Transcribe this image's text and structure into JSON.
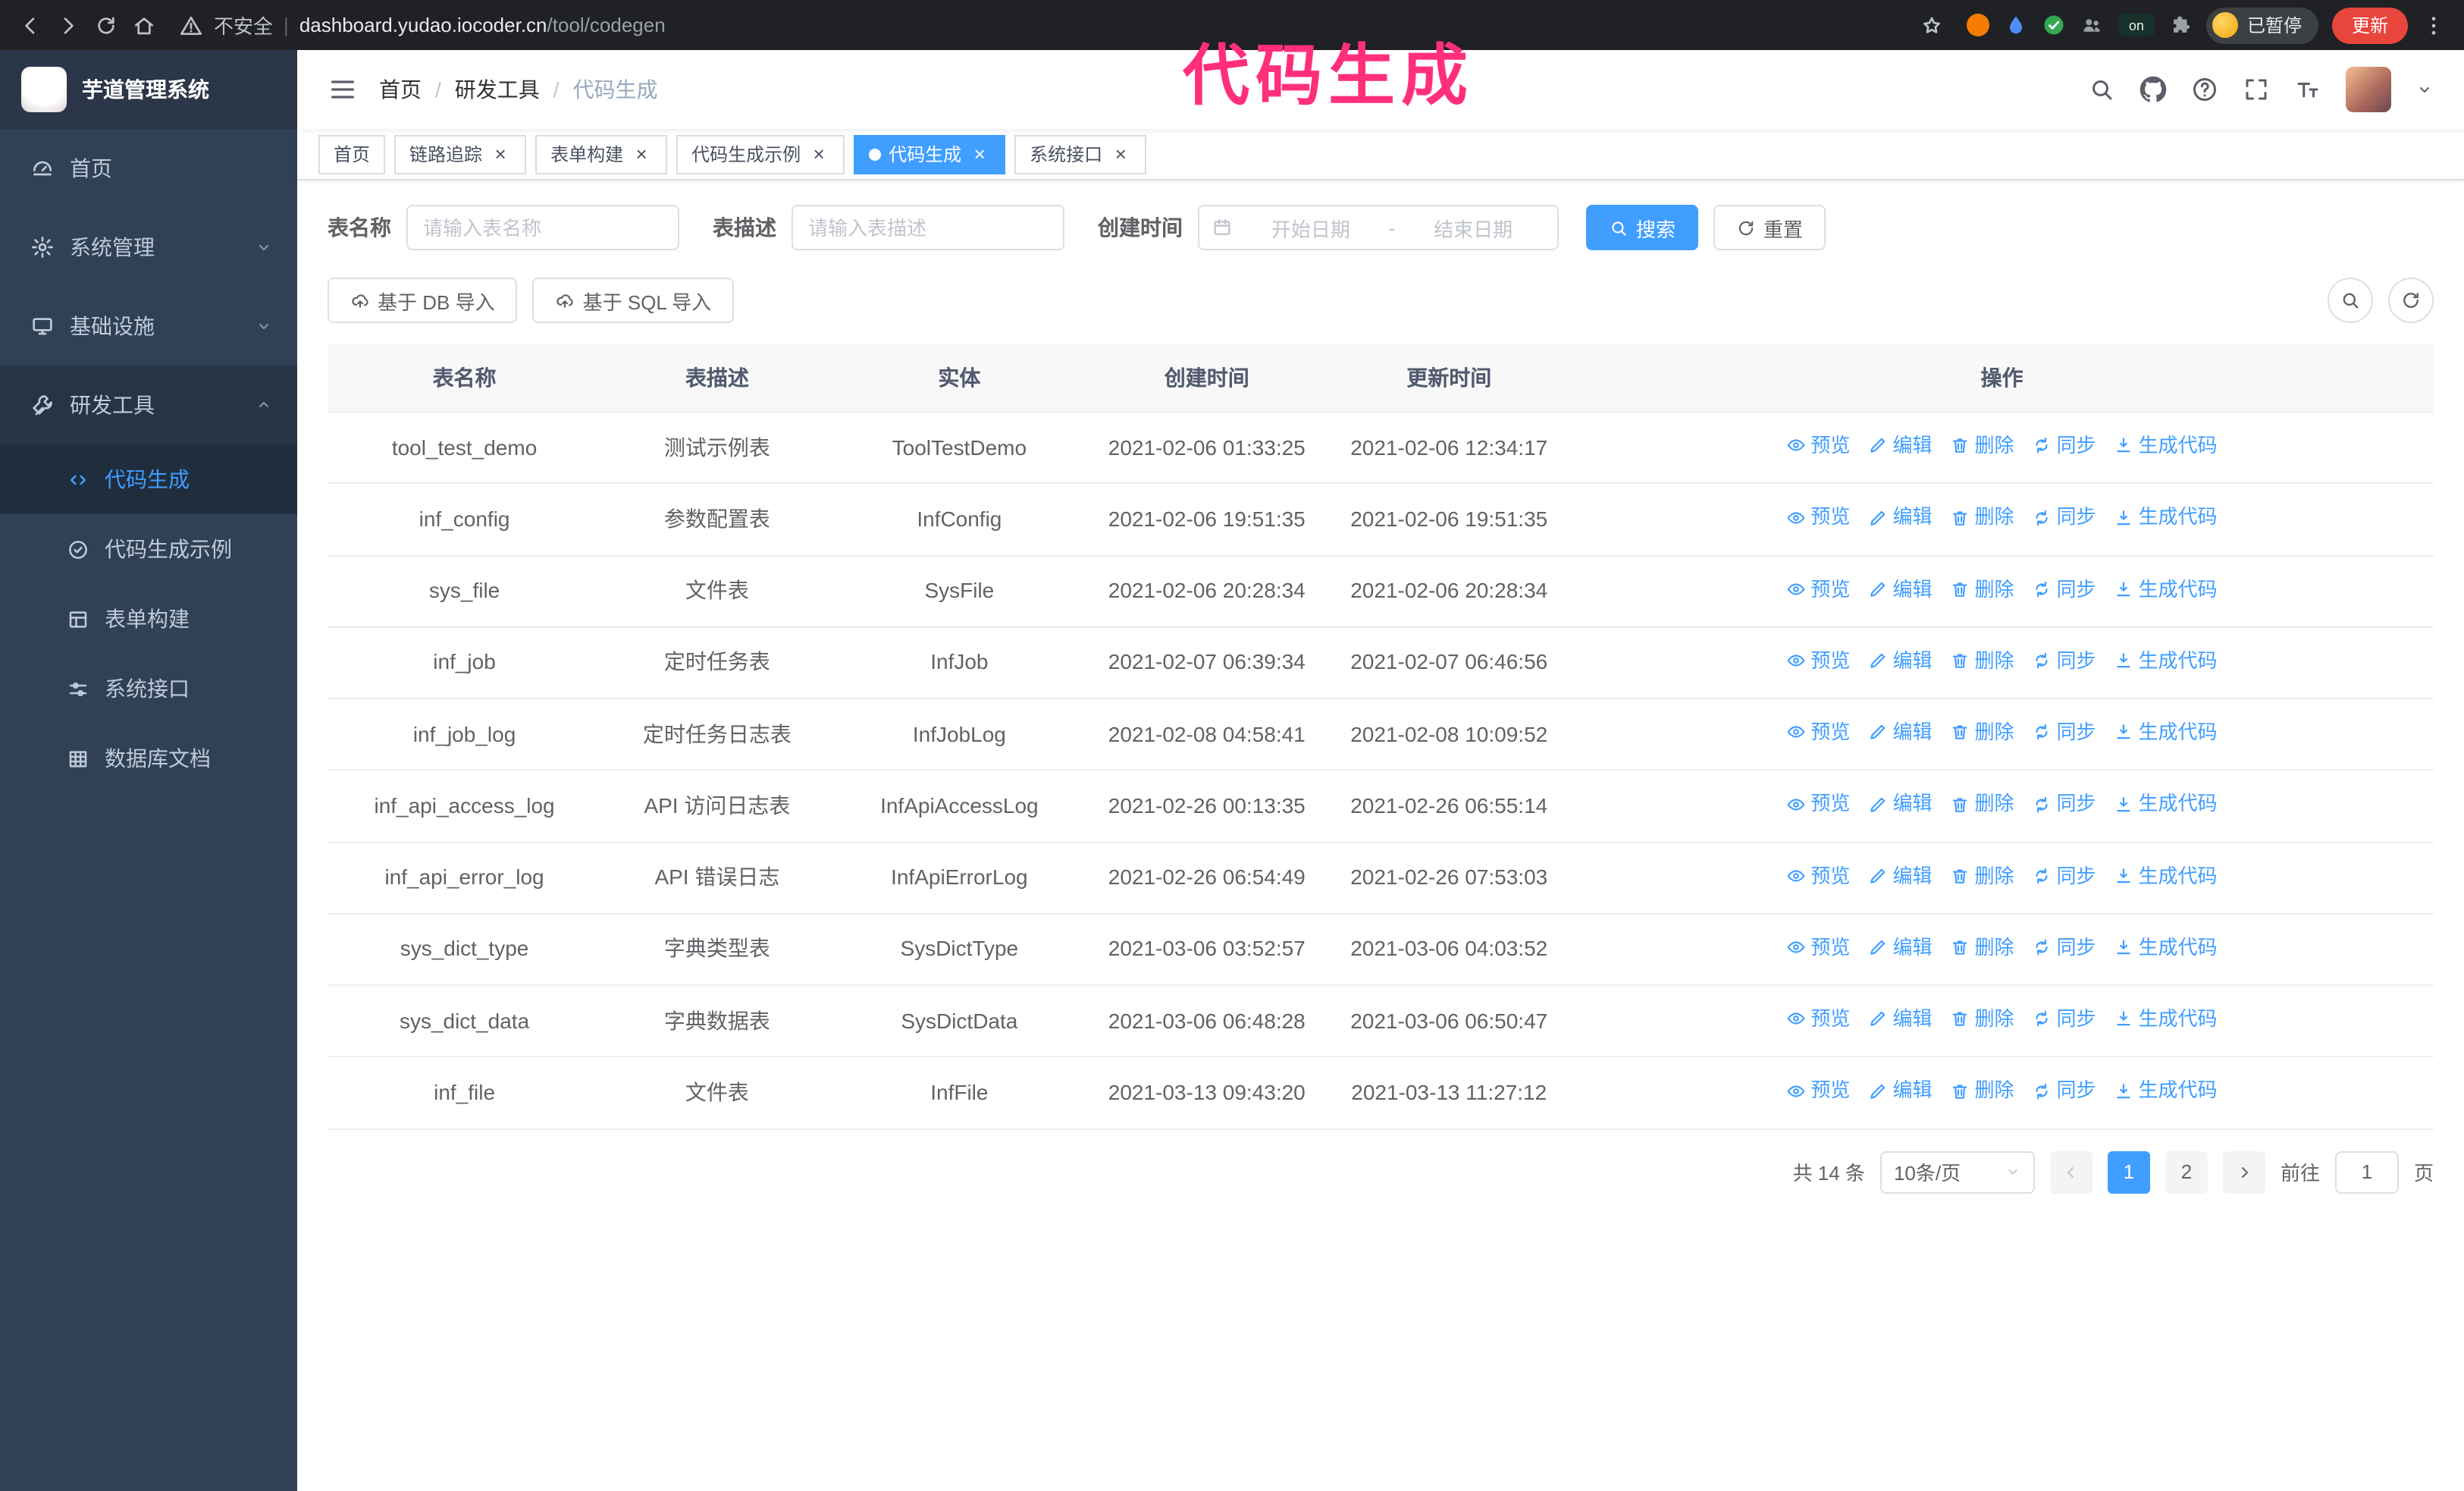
{
  "annotation": {
    "text": "代码生成",
    "color": "#ff2f7b"
  },
  "browser": {
    "security_label": "不安全",
    "url_host": "dashboard.yudao.iocoder.cn",
    "url_path": "/tool/codegen",
    "extension_on_badge": "on",
    "paused_badge": "已暂停",
    "update_button": "更新"
  },
  "sidebar": {
    "app_title": "芋道管理系统",
    "items": [
      {
        "id": "home",
        "label": "首页",
        "icon": "gauge",
        "expandable": false
      },
      {
        "id": "system",
        "label": "系统管理",
        "icon": "gear",
        "expandable": true,
        "expanded": false
      },
      {
        "id": "infra",
        "label": "基础设施",
        "icon": "monitor",
        "expandable": true,
        "expanded": false
      },
      {
        "id": "devtools",
        "label": "研发工具",
        "icon": "tools",
        "expandable": true,
        "expanded": true,
        "children": [
          {
            "id": "codegen",
            "label": "代码生成",
            "icon": "code",
            "active": true
          },
          {
            "id": "codegen-example",
            "label": "代码生成示例",
            "icon": "badge-check",
            "active": false
          },
          {
            "id": "form-builder",
            "label": "表单构建",
            "icon": "form",
            "active": false
          },
          {
            "id": "api",
            "label": "系统接口",
            "icon": "sliders",
            "active": false
          },
          {
            "id": "db-doc",
            "label": "数据库文档",
            "icon": "grid-table",
            "active": false
          }
        ]
      }
    ]
  },
  "header": {
    "breadcrumb": [
      "首页",
      "研发工具",
      "代码生成"
    ],
    "tools": [
      {
        "id": "search",
        "icon": "search"
      },
      {
        "id": "github",
        "icon": "github"
      },
      {
        "id": "help",
        "icon": "question"
      },
      {
        "id": "fullscreen",
        "icon": "fullscreen"
      },
      {
        "id": "font-size",
        "icon": "font-size"
      }
    ]
  },
  "tabs": [
    {
      "id": "home",
      "label": "首页",
      "closable": false,
      "active": false
    },
    {
      "id": "tracing",
      "label": "链路追踪",
      "closable": true,
      "active": false
    },
    {
      "id": "form-builder",
      "label": "表单构建",
      "closable": true,
      "active": false
    },
    {
      "id": "codegen-example",
      "label": "代码生成示例",
      "closable": true,
      "active": false
    },
    {
      "id": "codegen",
      "label": "代码生成",
      "closable": true,
      "active": true
    },
    {
      "id": "api",
      "label": "系统接口",
      "closable": true,
      "active": false
    }
  ],
  "filters": {
    "table_name_label": "表名称",
    "table_name_placeholder": "请输入表名称",
    "table_desc_label": "表描述",
    "table_desc_placeholder": "请输入表描述",
    "create_time_label": "创建时间",
    "date_start_placeholder": "开始日期",
    "date_separator": "-",
    "date_end_placeholder": "结束日期",
    "search_button": "搜索",
    "reset_button": "重置"
  },
  "toolbar": {
    "import_db_button": "基于 DB 导入",
    "import_sql_button": "基于 SQL 导入"
  },
  "table": {
    "columns": [
      "表名称",
      "表描述",
      "实体",
      "创建时间",
      "更新时间",
      "操作"
    ],
    "actions": [
      {
        "id": "preview",
        "label": "预览",
        "icon": "eye"
      },
      {
        "id": "edit",
        "label": "编辑",
        "icon": "edit"
      },
      {
        "id": "delete",
        "label": "删除",
        "icon": "trash"
      },
      {
        "id": "sync",
        "label": "同步",
        "icon": "sync"
      },
      {
        "id": "generate",
        "label": "生成代码",
        "icon": "download"
      }
    ],
    "rows": [
      {
        "name": "tool_test_demo",
        "desc": "测试示例表",
        "entity": "ToolTestDemo",
        "created": "2021-02-06 01:33:25",
        "updated": "2021-02-06 12:34:17"
      },
      {
        "name": "inf_config",
        "desc": "参数配置表",
        "entity": "InfConfig",
        "created": "2021-02-06 19:51:35",
        "updated": "2021-02-06 19:51:35"
      },
      {
        "name": "sys_file",
        "desc": "文件表",
        "entity": "SysFile",
        "created": "2021-02-06 20:28:34",
        "updated": "2021-02-06 20:28:34"
      },
      {
        "name": "inf_job",
        "desc": "定时任务表",
        "entity": "InfJob",
        "created": "2021-02-07 06:39:34",
        "updated": "2021-02-07 06:46:56"
      },
      {
        "name": "inf_job_log",
        "desc": "定时任务日志表",
        "entity": "InfJobLog",
        "created": "2021-02-08 04:58:41",
        "updated": "2021-02-08 10:09:52"
      },
      {
        "name": "inf_api_access_log",
        "desc": "API 访问日志表",
        "entity": "InfApiAccessLog",
        "created": "2021-02-26 00:13:35",
        "updated": "2021-02-26 06:55:14"
      },
      {
        "name": "inf_api_error_log",
        "desc": "API 错误日志",
        "entity": "InfApiErrorLog",
        "created": "2021-02-26 06:54:49",
        "updated": "2021-02-26 07:53:03"
      },
      {
        "name": "sys_dict_type",
        "desc": "字典类型表",
        "entity": "SysDictType",
        "created": "2021-03-06 03:52:57",
        "updated": "2021-03-06 04:03:52"
      },
      {
        "name": "sys_dict_data",
        "desc": "字典数据表",
        "entity": "SysDictData",
        "created": "2021-03-06 06:48:28",
        "updated": "2021-03-06 06:50:47"
      },
      {
        "name": "inf_file",
        "desc": "文件表",
        "entity": "InfFile",
        "created": "2021-03-13 09:43:20",
        "updated": "2021-03-13 11:27:12"
      }
    ]
  },
  "pagination": {
    "total_text": "共 14 条",
    "page_size": "10条/页",
    "pages": [
      "1",
      "2"
    ],
    "active_page": "1",
    "goto_prefix": "前往",
    "goto_value": "1",
    "goto_suffix": "页"
  }
}
